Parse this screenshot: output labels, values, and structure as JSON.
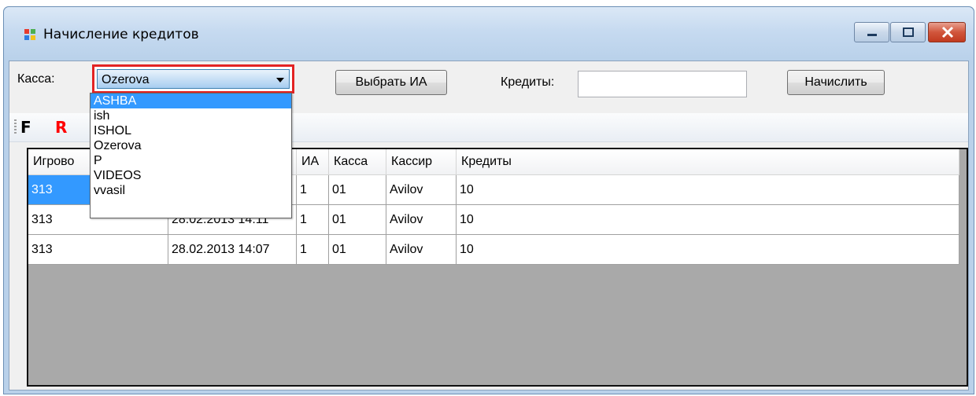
{
  "window": {
    "title": "Начисление кредитов",
    "minimize_glyph": "▁",
    "maximize_glyph": "□",
    "close_glyph": "✕"
  },
  "form": {
    "kassa_label": "Касса:",
    "kassa_value": "Ozerova",
    "select_ia_button": "Выбрать ИА",
    "credits_label": "Кредиты:",
    "credits_value": "",
    "accrue_button": "Начислить"
  },
  "toolbar": {
    "f_button": "F",
    "r_button": "R"
  },
  "dropdown": {
    "options": [
      "ASHBA",
      "ish",
      "ISHOL",
      "Ozerova",
      "P",
      "VIDEOS",
      "vvasil"
    ],
    "highlighted": "ASHBA"
  },
  "grid": {
    "columns": [
      "Игрово",
      "",
      "ИА",
      "Касса",
      "Кассир",
      "Кредиты"
    ],
    "rows": [
      [
        "313",
        "",
        "1",
        "01",
        "Avilov",
        "10"
      ],
      [
        "313",
        "28.02.2013 14:11",
        "1",
        "01",
        "Avilov",
        "10"
      ],
      [
        "313",
        "28.02.2013 14:07",
        "1",
        "01",
        "Avilov",
        "10"
      ]
    ]
  },
  "colors": {
    "selection": "#3399ff",
    "highlight_border": "#e32323",
    "r_button_color": "#ff0000"
  }
}
